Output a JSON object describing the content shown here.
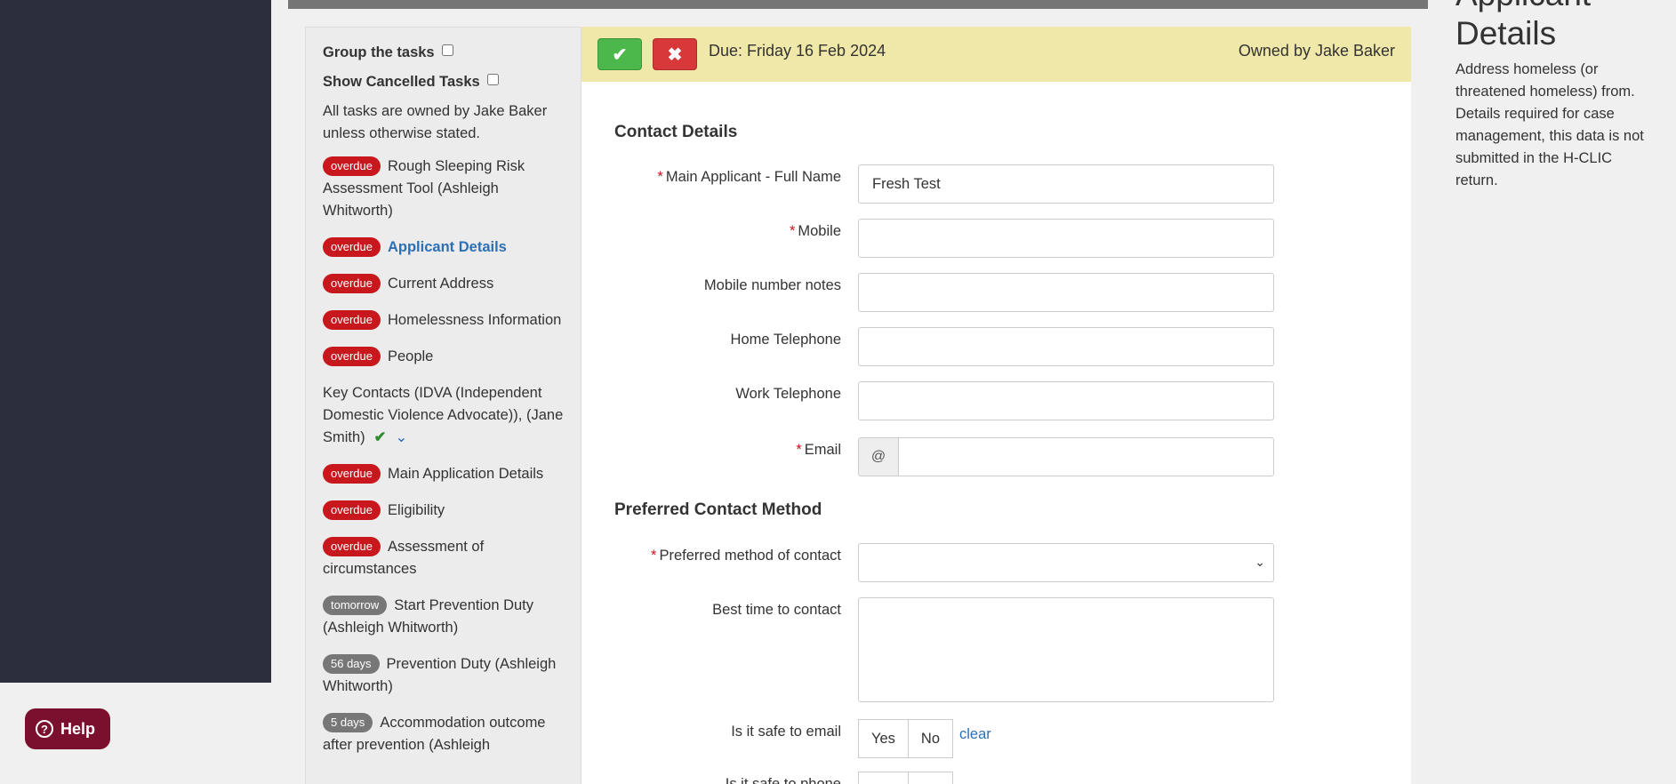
{
  "help": {
    "label": "Help",
    "icon": "help-circle-icon"
  },
  "tasks": {
    "group_label": "Group the tasks",
    "cancelled_label": "Show Cancelled Tasks",
    "note": "All tasks are owned by Jake Baker unless otherwise stated.",
    "items": [
      {
        "badge": "overdue",
        "label": "Rough Sleeping Risk Assessment Tool (Ashleigh Whitworth)"
      },
      {
        "badge": "overdue",
        "label": "Applicant Details"
      },
      {
        "badge": "overdue",
        "label": "Current Address"
      },
      {
        "badge": "overdue",
        "label": "Homelessness Information"
      },
      {
        "badge": "overdue",
        "label": "People"
      },
      {
        "badge": "",
        "label": "Key Contacts (IDVA (Independent Domestic Violence Advocate)), (Jane Smith)"
      },
      {
        "badge": "overdue",
        "label": "Main Application Details"
      },
      {
        "badge": "overdue",
        "label": "Eligibility"
      },
      {
        "badge": "overdue",
        "label": "Assessment of circumstances"
      },
      {
        "badge": "tomorrow",
        "label": "Start Prevention Duty (Ashleigh Whitworth)"
      },
      {
        "badge": "56 days",
        "label": "Prevention Duty (Ashleigh Whitworth)"
      },
      {
        "badge": "5 days",
        "label": "Accommodation outcome after prevention (Ashleigh"
      }
    ]
  },
  "due_bar": {
    "due": "Due: Friday 16 Feb 2024",
    "owner": "Owned by Jake Baker",
    "color": "#efe8a9"
  },
  "form": {
    "contact_title": "Contact Details",
    "full_name_label": "Main Applicant - Full Name",
    "full_name_value": "Fresh Test",
    "mobile_label": "Mobile",
    "mobile_notes_label": "Mobile number notes",
    "home_tel_label": "Home Telephone",
    "work_tel_label": "Work Telephone",
    "email_label": "Email",
    "email_addon": "@",
    "preferred_title": "Preferred Contact Method",
    "preferred_label": "Preferred method of contact",
    "best_time_label": "Best time to contact",
    "safe_email_label": "Is it safe to email",
    "safe_phone_label": "Is it safe to phone",
    "yes": "Yes",
    "no": "No",
    "clear": "clear"
  },
  "right_panel": {
    "title": "Applicant Details",
    "description": "Address homeless (or threatened homeless) from. Details required for case management, this data is not submitted in the H-CLIC return."
  },
  "colors": {
    "nav_bg": "#2c2d3d",
    "help_bg": "#7a0f2e",
    "overdue": "#c9171e",
    "badge_grey": "#777777",
    "link": "#2c6fb5",
    "ok_button": "#4cb84c",
    "cancel_button": "#d9383a"
  }
}
